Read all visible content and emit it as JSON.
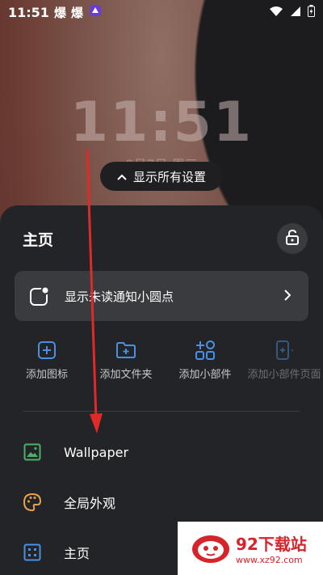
{
  "status_bar": {
    "time": "11:51",
    "app_badge_1": "爆",
    "app_badge_2": "爆"
  },
  "lockscreen": {
    "time": "11:51",
    "date": "9月7日 周三"
  },
  "show_settings": {
    "label": "显示所有设置"
  },
  "sheet": {
    "title": "主页",
    "notification_row": {
      "label": "显示未读通知小圆点"
    },
    "actions": [
      {
        "label": "添加图标",
        "icon": "add-square-icon"
      },
      {
        "label": "添加文件夹",
        "icon": "add-folder-icon"
      },
      {
        "label": "添加小部件",
        "icon": "widgets-icon"
      },
      {
        "label": "添加小部件页面",
        "icon": "add-page-icon"
      }
    ],
    "menu": [
      {
        "label": "Wallpaper",
        "icon": "image-icon"
      },
      {
        "label": "全局外观",
        "icon": "palette-icon"
      },
      {
        "label": "主页",
        "icon": "home-grid-icon"
      }
    ]
  },
  "watermark": {
    "title": "92下载站",
    "url": "www.xz92.com"
  },
  "colors": {
    "accent_blue": "#4a90e2",
    "sheet_bg": "#232427",
    "arrow_red": "#e02a2a"
  }
}
